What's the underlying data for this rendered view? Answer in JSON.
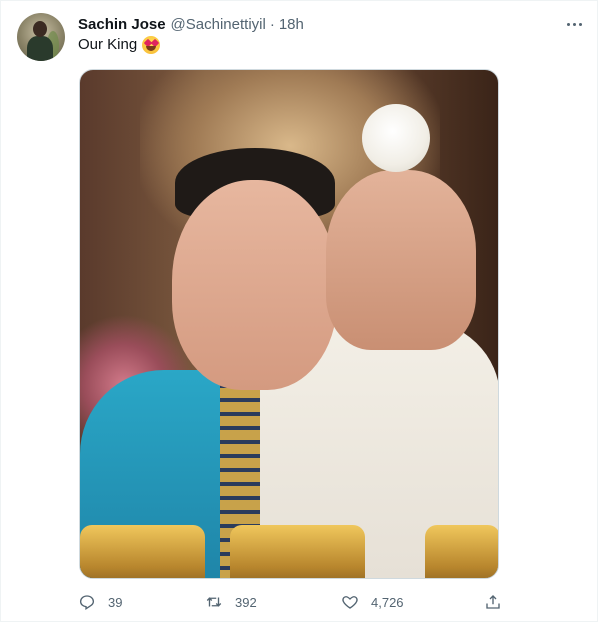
{
  "tweet": {
    "author": {
      "name": "Sachin Jose",
      "handle": "@Sachinettiyil",
      "separator": "·",
      "time": "18h",
      "avatar_icon": "avatar-photo"
    },
    "text": "Our King",
    "emoji": "smiling-face-with-heart-eyes",
    "media_icon": "photo-priest-elevating-host",
    "actions": {
      "reply": {
        "icon": "reply-icon",
        "count": "39"
      },
      "retweet": {
        "icon": "retweet-icon",
        "count": "392"
      },
      "like": {
        "icon": "heart-icon",
        "count": "4,726"
      },
      "share": {
        "icon": "share-icon"
      }
    }
  },
  "colors": {
    "text_primary": "#0f1419",
    "text_secondary": "#536471",
    "border": "#eff3f4"
  }
}
